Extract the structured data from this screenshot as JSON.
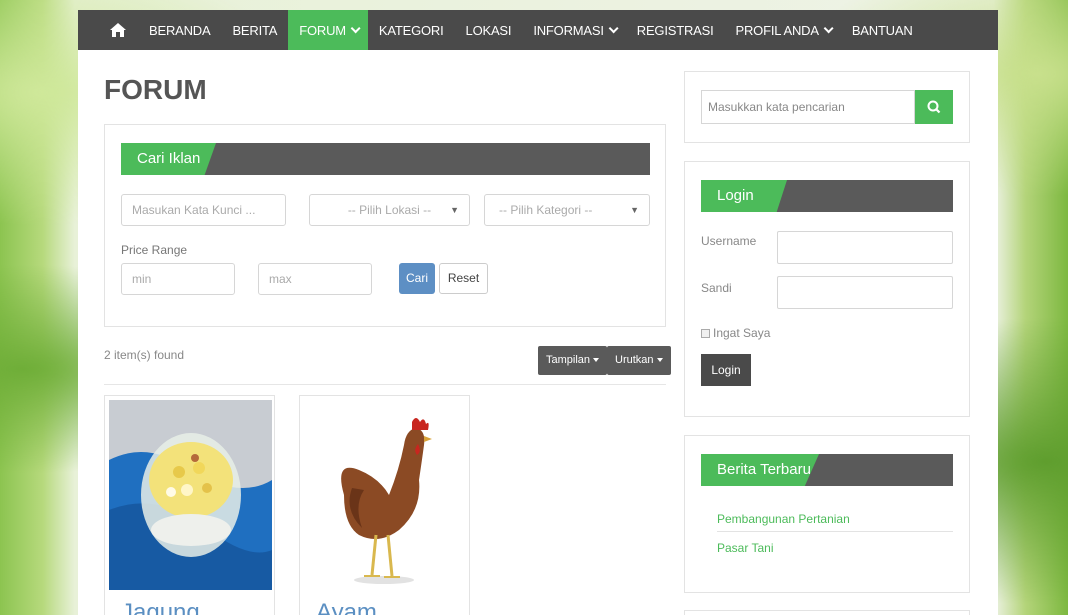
{
  "nav": {
    "home_icon": "home-icon",
    "items": [
      {
        "label": "BERANDA"
      },
      {
        "label": "BERITA"
      },
      {
        "label": "FORUM",
        "active": true,
        "dropdown": true
      },
      {
        "label": "KATEGORI"
      },
      {
        "label": "LOKASI"
      },
      {
        "label": "INFORMASI",
        "dropdown": true
      },
      {
        "label": "REGISTRASI"
      },
      {
        "label": "PROFIL ANDA",
        "dropdown": true
      },
      {
        "label": "BANTUAN"
      }
    ]
  },
  "page_title": "FORUM",
  "search_panel": {
    "title": "Cari Iklan",
    "keyword_placeholder": "Masukan Kata Kunci ...",
    "location_select": "-- Pilih Lokasi --",
    "category_select": "-- Pilih Kategori --",
    "price_range_label": "Price Range",
    "min_placeholder": "min",
    "max_placeholder": "max",
    "search_button": "Cari",
    "reset_button": "Reset"
  },
  "results": {
    "found_text": "2 item(s) found",
    "view_button": "Tampilan",
    "sort_button": "Urutkan",
    "items": [
      {
        "name": "Jagung",
        "image": "corn-jar-image"
      },
      {
        "name": "Ayam",
        "image": "chicken-image"
      }
    ]
  },
  "sidebar": {
    "search_placeholder": "Masukkan kata pencarian",
    "search_icon": "search-icon",
    "login": {
      "title": "Login",
      "username_label": "Username",
      "password_label": "Sandi",
      "remember_label": "Ingat Saya",
      "login_button": "Login"
    },
    "news": {
      "title": "Berita Terbaru",
      "links": [
        "Pembangunan Pertanian",
        "Pasar Tani"
      ]
    }
  },
  "colors": {
    "accent_green": "#4cbb5a",
    "nav_dark": "#4a4a4a",
    "link_blue": "#5b8fc2",
    "button_blue": "#5d8fc4"
  }
}
